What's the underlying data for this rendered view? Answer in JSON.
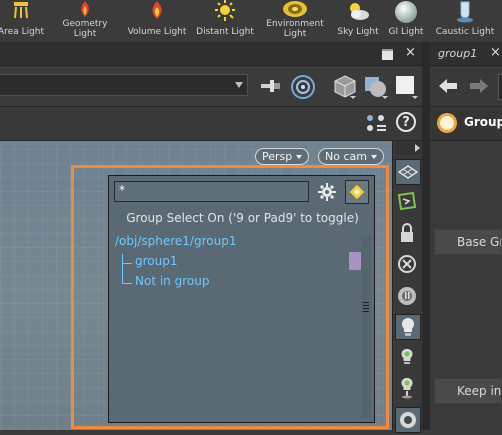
{
  "shelf": {
    "tools": [
      {
        "label": "Area Light",
        "icon": "area-light-icon"
      },
      {
        "label": "Geometry Light",
        "icon": "geometry-light-icon"
      },
      {
        "label": "Volume Light",
        "icon": "volume-light-icon"
      },
      {
        "label": "Distant Light",
        "icon": "distant-light-icon"
      },
      {
        "label": "Environment Light",
        "icon": "environment-light-icon"
      },
      {
        "label": "Sky Light",
        "icon": "sky-light-icon"
      },
      {
        "label": "GI Light",
        "icon": "gi-light-icon"
      },
      {
        "label": "Caustic Light",
        "icon": "caustic-light-icon"
      }
    ]
  },
  "viewport": {
    "camera_menu": "Persp",
    "cam_menu": "No cam"
  },
  "group_select": {
    "pattern_value": "*",
    "info": "Group Select On ('9 or Pad9' to toggle)",
    "tree": {
      "root": "/obj/sphere1/group1",
      "children": [
        "group1",
        "Not in group"
      ]
    }
  },
  "right_pane": {
    "tab_label": "group1",
    "node_type": "Group",
    "field1": "Base Gro",
    "field2": "Keep in B"
  },
  "colors": {
    "highlight": "#ef8a3e",
    "tree_text": "#6fc7ff",
    "swatch": "#a793c1"
  }
}
